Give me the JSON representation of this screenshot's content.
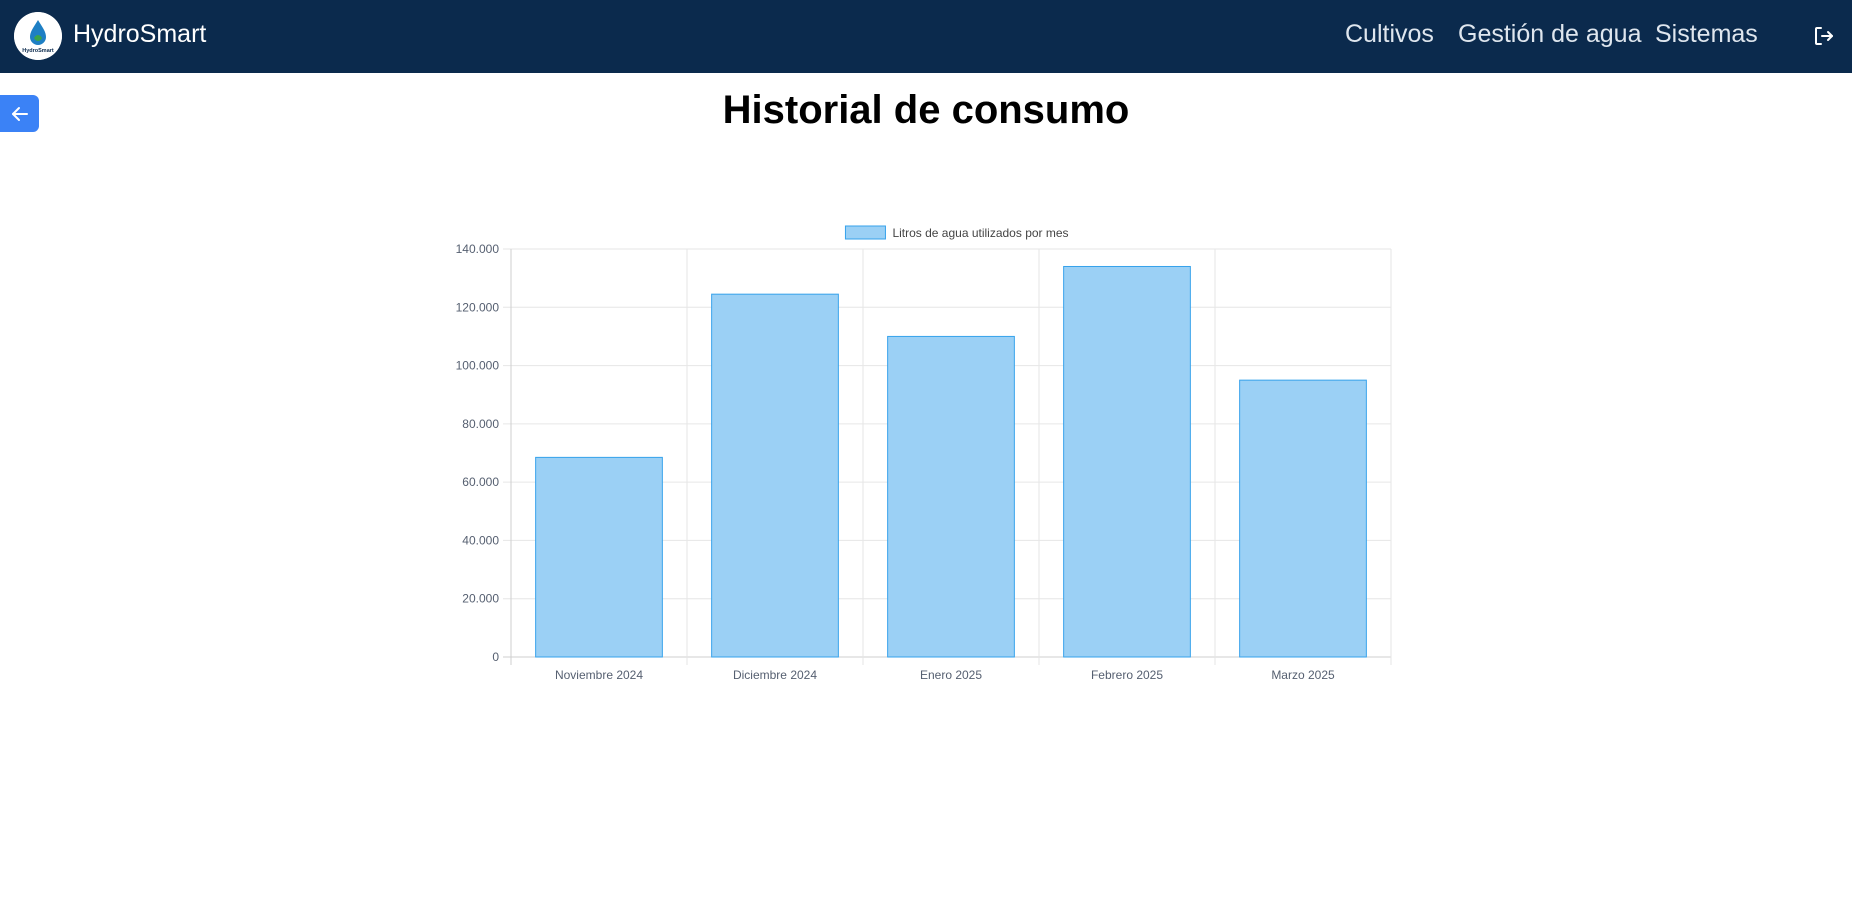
{
  "navbar": {
    "brand": "HydroSmart",
    "logo_text": "HydroSmart",
    "links": [
      "Cultivos",
      "Gestión de agua",
      "Sistemas"
    ],
    "logout_icon": "logout-icon",
    "background": "#0b2a4d"
  },
  "page": {
    "title": "Historial de consumo",
    "back_icon": "arrow-left-icon",
    "accent": "#3b82f6"
  },
  "chart_data": {
    "type": "bar",
    "categories": [
      "Noviembre 2024",
      "Diciembre 2024",
      "Enero 2025",
      "Febrero 2025",
      "Marzo 2025"
    ],
    "series": [
      {
        "name": "Litros de agua utilizados por mes",
        "values": [
          68500,
          124500,
          110000,
          134000,
          95000
        ]
      }
    ],
    "ylim": [
      0,
      140000
    ],
    "yticks": [
      "0",
      "20.000",
      "40.000",
      "60.000",
      "80.000",
      "100.000",
      "120.000",
      "140.000"
    ],
    "grid": true,
    "legend": "top",
    "bar_fill": "#9bd0f5",
    "bar_stroke": "#36a2eb"
  }
}
